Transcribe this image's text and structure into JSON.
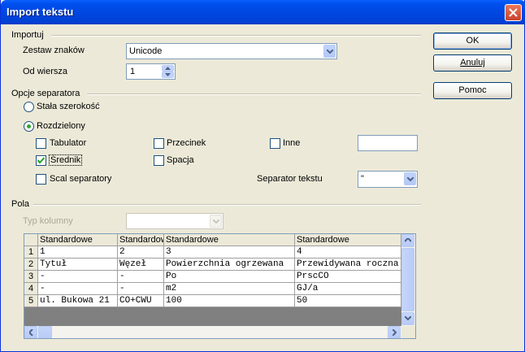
{
  "window": {
    "title": "Import tekstu"
  },
  "buttons": {
    "ok": "OK",
    "cancel": "Anuluj",
    "help": "Pomoc"
  },
  "import_group": {
    "label": "Importuj",
    "charset_label": "Zestaw znaków",
    "charset_value": "Unicode",
    "from_row_label": "Od wiersza",
    "from_row_value": "1"
  },
  "separator_group": {
    "label": "Opcje separatora",
    "fixed_width": "Stała szerokość",
    "separated": "Rozdzielony",
    "tab": "Tabulator",
    "comma": "Przecinek",
    "other": "Inne",
    "other_value": "",
    "semicolon": "Średnik",
    "space": "Spacja",
    "merge": "Scal separatory",
    "text_sep_label": "Separator tekstu",
    "text_sep_value": "\""
  },
  "fields_group": {
    "label": "Pola",
    "column_type_label": "Typ kolumny",
    "column_type_value": ""
  },
  "grid": {
    "headers": [
      "Standardowe",
      "Standardowe",
      "Standardowe",
      "Standardowe"
    ],
    "rows": [
      {
        "num": "1",
        "cells": [
          "1",
          "2",
          "3",
          "4"
        ]
      },
      {
        "num": "2",
        "cells": [
          "Tytuł",
          "Węzeł",
          "Powierzchnia ogrzewana",
          "Przewidywana roczna"
        ]
      },
      {
        "num": "3",
        "cells": [
          "-",
          "-",
          "Po",
          "PrscCO"
        ]
      },
      {
        "num": "4",
        "cells": [
          "-",
          "-",
          "m2",
          "GJ/a"
        ]
      },
      {
        "num": "5",
        "cells": [
          "ul. Bukowa 21",
          "CO+CWU",
          "100",
          "50"
        ]
      }
    ]
  },
  "colors": {
    "titlebar": "#0046e0",
    "dialog_bg": "#ece9d8",
    "checkbox_check": "#21a121"
  },
  "icons": [
    "close-icon",
    "dropdown-arrow-icon",
    "spin-up-icon",
    "spin-down-icon",
    "check-icon",
    "scroll-up-icon",
    "scroll-down-icon",
    "scroll-left-icon",
    "scroll-right-icon"
  ]
}
